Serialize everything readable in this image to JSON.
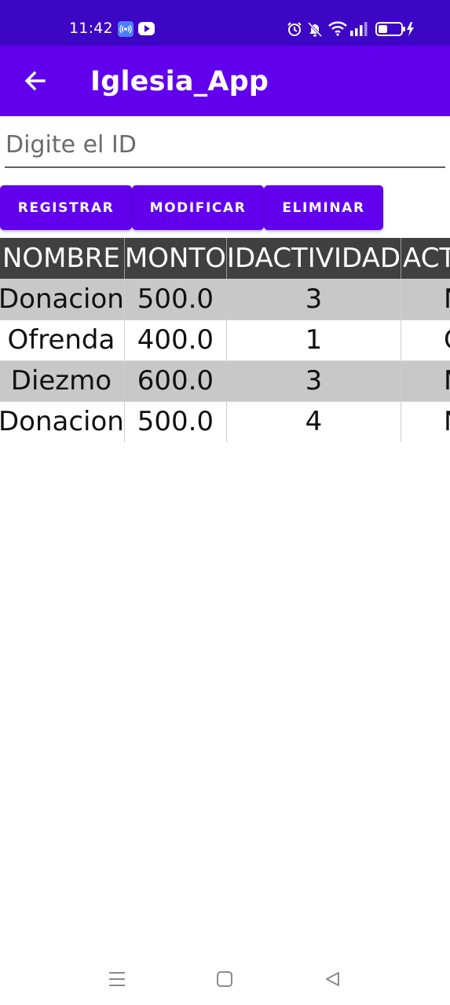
{
  "status_bar": {
    "time": "11:42",
    "icons": [
      "hotspot-icon",
      "youtube-icon",
      "alarm-icon",
      "mute-icon",
      "wifi-icon",
      "signal-icon",
      "battery-icon"
    ]
  },
  "app_bar": {
    "title": "Iglesia_App",
    "back_icon": "arrow-back-icon"
  },
  "form": {
    "id_placeholder": "Digite el ID",
    "id_value": ""
  },
  "buttons": {
    "register": "REGISTRAR",
    "modify": "MODIFICAR",
    "delete": "ELIMINAR"
  },
  "table": {
    "headers": [
      "NOMBRE",
      "MONTO",
      "IDACTIVIDAD",
      "ACT"
    ],
    "rows": [
      [
        "Donacion",
        "500.0",
        "3",
        "N"
      ],
      [
        "Ofrenda",
        "400.0",
        "1",
        "C"
      ],
      [
        "Diezmo",
        "600.0",
        "3",
        "N"
      ],
      [
        "Donacion",
        "500.0",
        "4",
        "N"
      ]
    ]
  },
  "nav_bar": {
    "icons": [
      "menu-icon",
      "home-icon",
      "back-triangle-icon"
    ]
  },
  "colors": {
    "status_bar": "#3d06c4",
    "app_bar": "#6200ee",
    "button": "#6200ee",
    "table_header": "#404040",
    "row_shade": "#c8c8c8"
  }
}
